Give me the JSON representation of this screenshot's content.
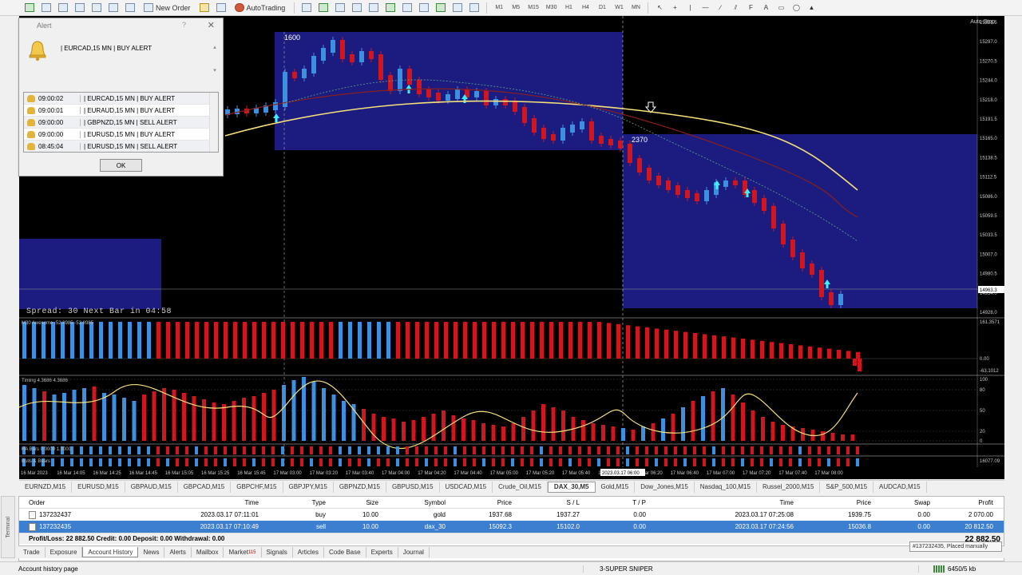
{
  "toolbar": {
    "new_order_label": "New Order",
    "autotrading_label": "AutoTrading",
    "timeframes": [
      "M1",
      "M5",
      "M15",
      "M30",
      "H1",
      "H4",
      "D1",
      "W1",
      "MN"
    ]
  },
  "chart": {
    "auto_stop": "Auto Stop",
    "spread_text": "Spread: 30  Next Bar in 04:58",
    "box_label_1": "1600",
    "box_label_2": "2370",
    "ao_label": "M30 Awesome -52.8985 -52.8985",
    "timing_label": "Timing 4.3686 4.3686",
    "habars_label": "HA Bars 0.0000 1.0000",
    "bulls_label": "Bulls & Bears",
    "price_ticks": [
      "15323.5",
      "15297.0",
      "15270.5",
      "15244.0",
      "15218.0",
      "15191.5",
      "15165.0",
      "15138.5",
      "15112.5",
      "15086.0",
      "15059.5",
      "15033.5",
      "15007.0",
      "14980.5",
      "14954.0",
      "14928.0"
    ],
    "price_badge": "14963.3",
    "ao_ticks": [
      "161.3571",
      "0.00",
      "-63.1012"
    ],
    "timing_ticks": [
      "100",
      "80",
      "50",
      "20",
      "0"
    ],
    "time_ticks": [
      "16 Mar 2023",
      "16 Mar 14:05",
      "16 Mar 14:25",
      "16 Mar 14:45",
      "16 Mar 15:05",
      "16 Mar 15:25",
      "16 Mar 15:45",
      "17 Mar 03:00",
      "17 Mar 03:20",
      "17 Mar 03:40",
      "17 Mar 04:00",
      "17 Mar 04:20",
      "17 Mar 04:40",
      "17 Mar 05:00",
      "17 Mar 05:20",
      "17 Mar 05:40",
      "17 Mar 06:00",
      "17 Mar 06:20",
      "17 Mar 06:40",
      "17 Mar 07:00",
      "17 Mar 07:20",
      "17 Mar 07:40",
      "17 Mar 08:00"
    ],
    "crosshair_time": "2023.03.17 06:00",
    "bottom_right_value": "16077.09"
  },
  "alert": {
    "title": "Alert",
    "help": "?",
    "message": "|  EURCAD,15 MN  |  BUY ALERT",
    "rows": [
      {
        "time": "09:00:02",
        "msg": "|  EURCAD,15 MN  |  BUY ALERT"
      },
      {
        "time": "09:00:01",
        "msg": "|  EURAUD,15 MN  |  BUY ALERT"
      },
      {
        "time": "09:00:00",
        "msg": "|  GBPNZD,15 MN  |  SELL ALERT"
      },
      {
        "time": "09:00:00",
        "msg": "|  EURUSD,15 MN  |  BUY ALERT"
      },
      {
        "time": "08:45:04",
        "msg": "|  EURUSD,15 MN  |  SELL ALERT"
      }
    ],
    "ok_label": "OK"
  },
  "symbol_tabs": [
    "EURNZD,M15",
    "EURUSD,M15",
    "GBPAUD,M15",
    "GBPCAD,M15",
    "GBPCHF,M15",
    "GBPJPY,M15",
    "GBPNZD,M15",
    "GBPUSD,M15",
    "USDCAD,M15",
    "Crude_Oil,M15",
    "DAX_30,M5",
    "Gold,M15",
    "Dow_Jones,M15",
    "Nasdaq_100,M15",
    "Russel_2000,M15",
    "S&P_500,M15",
    "AUDCAD,M15"
  ],
  "active_symbol_tab": "DAX_30,M5",
  "terminal": {
    "side_label": "Terminal",
    "columns": {
      "order": "Order",
      "time": "Time",
      "type": "Type",
      "size": "Size",
      "symbol": "Symbol",
      "price": "Price",
      "sl": "S / L",
      "tp": "T / P",
      "time2": "Time",
      "price2": "Price",
      "swap": "Swap",
      "profit": "Profit"
    },
    "rows": [
      {
        "order": "137232437",
        "time": "2023.03.17 07:11:01",
        "type": "buy",
        "size": "10.00",
        "symbol": "gold",
        "price": "1937.68",
        "sl": "1937.27",
        "tp": "0.00",
        "time2": "2023.03.17 07:25:08",
        "price2": "1939.75",
        "swap": "0.00",
        "profit": "2 070.00"
      },
      {
        "order": "137232435",
        "time": "2023.03.17 07:10:49",
        "type": "sell",
        "size": "10.00",
        "symbol": "dax_30",
        "price": "15092.3",
        "sl": "15102.0",
        "tp": "0.00",
        "time2": "2023.03.17 07:24:56",
        "price2": "15036.8",
        "swap": "0.00",
        "profit": "20 812.50"
      }
    ],
    "summary": "Profit/Loss: 22 882.50  Credit: 0.00  Deposit: 0.00  Withdrawal: 0.00",
    "summary_value": "22 882.50",
    "tabs": [
      "Trade",
      "Exposure",
      "Account History",
      "News",
      "Alerts",
      "Mailbox",
      "Market",
      "Signals",
      "Articles",
      "Code Base",
      "Experts",
      "Journal"
    ],
    "market_badge": "115",
    "active_tab": "Account History",
    "tooltip": "#137232435, Placed manually"
  },
  "status": {
    "left": "Account history page",
    "profile": "3-SUPER SNIPER",
    "traffic": "6450/5 kb"
  },
  "colors": {
    "bull": "#3d8fe0",
    "bear": "#d0161e",
    "box": "#1c1c80",
    "ma": "#f5e07a"
  }
}
